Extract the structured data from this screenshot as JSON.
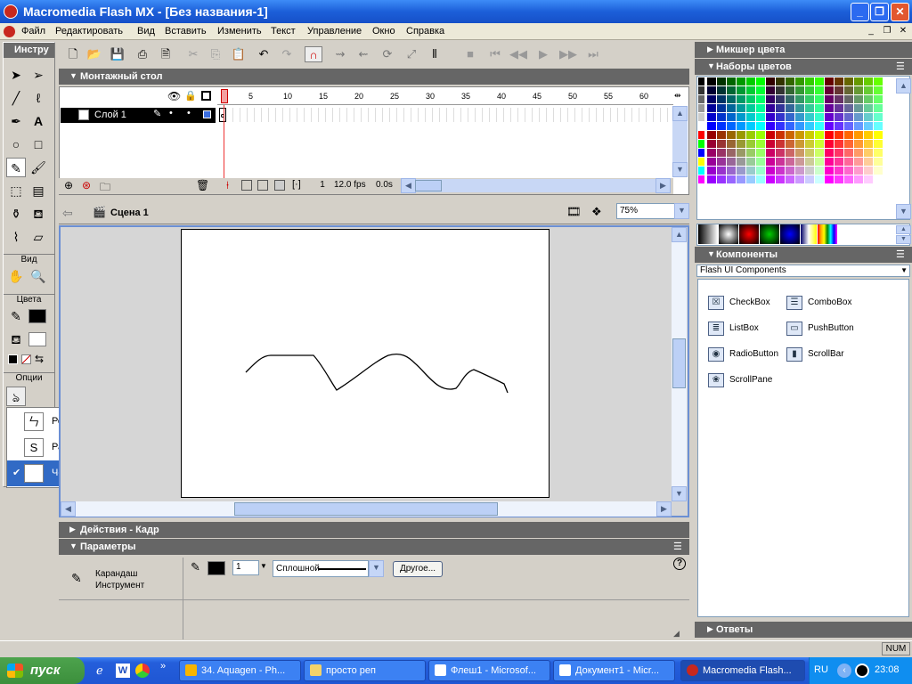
{
  "window": {
    "title": "Macromedia Flash MX - [Без названия-1]"
  },
  "menu": [
    "Файл",
    "Редактировать",
    "Вид",
    "Вставить",
    "Изменить",
    "Текст",
    "Управление",
    "Окно",
    "Справка"
  ],
  "tools": {
    "header": "Инстру",
    "view_label": "Вид",
    "colors_label": "Цвета",
    "options_label": "Опции"
  },
  "pencil_modes": [
    {
      "label": "Резкость",
      "icon": "ㄣ",
      "checked": false
    },
    {
      "label": "Размыть",
      "icon": "S",
      "checked": false
    },
    {
      "label": "Чернила",
      "icon": "ঌ",
      "checked": true
    }
  ],
  "timeline": {
    "header": "Монтажный стол",
    "layer_name": "Слой 1",
    "frame_numbers": [
      "1",
      "5",
      "10",
      "15",
      "20",
      "25",
      "30",
      "35",
      "40",
      "45",
      "50",
      "55",
      "60"
    ],
    "current_frame": "1",
    "fps": "12.0 fps",
    "time": "0.0s"
  },
  "scene": {
    "name": "Сцена 1",
    "zoom": "75%"
  },
  "panels": {
    "actions": "Действия - Кадр",
    "parameters": "Параметры",
    "color_mixer": "Микшер цвета",
    "color_swatches": "Наборы цветов",
    "components": "Компоненты",
    "answers": "Ответы"
  },
  "properties": {
    "tool_name": "Карандаш",
    "tool_type": "Инструмент",
    "stroke_width": "1",
    "stroke_style": "Сплошной",
    "custom_button": "Другое...",
    "stroke_color": "#000000"
  },
  "components": {
    "dropdown": "Flash UI Components",
    "items": [
      "CheckBox",
      "ComboBox",
      "ListBox",
      "PushButton",
      "RadioButton",
      "ScrollBar",
      "ScrollPane"
    ]
  },
  "status": {
    "num": "NUM"
  },
  "taskbar": {
    "start": "пуск",
    "tasks": [
      "34. Aquagen - Ph...",
      "просто реп",
      "Флеш1 - Microsof...",
      "Документ1 - Micr...",
      "Macromedia Flash..."
    ],
    "lang": "RU",
    "clock": "23:08"
  }
}
